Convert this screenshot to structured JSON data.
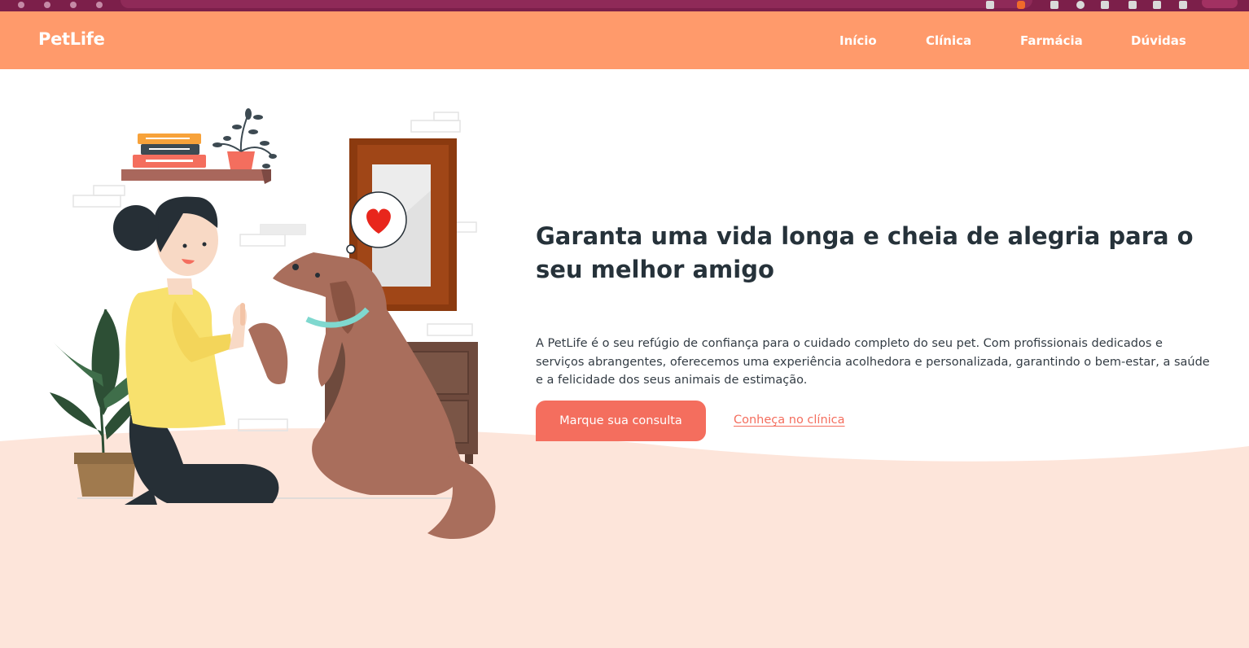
{
  "nav": {
    "brand": "PetLife",
    "links": [
      "Início",
      "Clínica",
      "Farmácia",
      "Dúvidas"
    ]
  },
  "hero": {
    "title": "Garanta uma vida longa e cheia de alegria para o seu melhor amigo",
    "description": "A PetLife é o seu refúgio de confiança para o cuidado completo do seu pet. Com profissionais dedicados e serviços abrangentes, oferecemos uma experiência acolhedora e personalizada, garantindo o bem-estar, a saúde e a felicidade dos seus animais de estimação.",
    "primary_button": "Marque sua consulta",
    "secondary_link": "Conheça no clínica"
  },
  "colors": {
    "navbar": "#ff9a6b",
    "accent": "#f46e5e",
    "wave": "#fde5da",
    "title": "#26323a",
    "browser_chrome": "#7c1f4a"
  },
  "illustration": {
    "icon": "woman-high-fiving-dog-illustration",
    "speech_icon": "heart-icon"
  }
}
